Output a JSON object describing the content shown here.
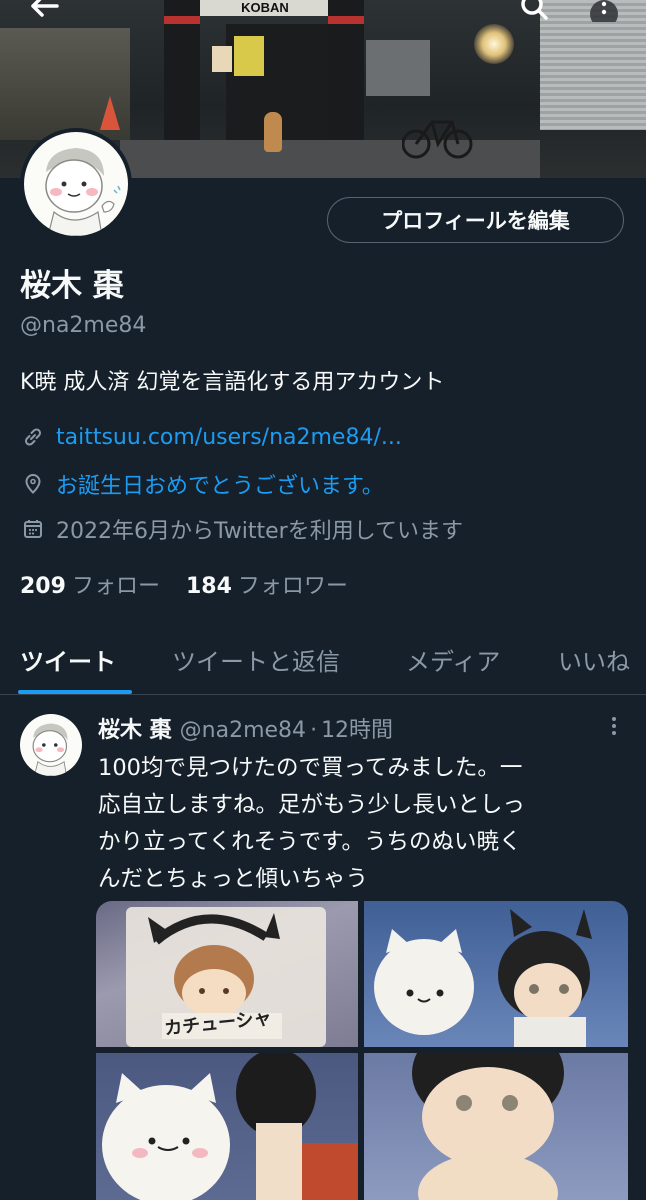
{
  "banner": {
    "sign_text": "KOBAN"
  },
  "topbar": {
    "back_icon": "arrow-left-icon",
    "search_icon": "search-icon",
    "more_icon": "more-vertical-icon"
  },
  "profile": {
    "edit_button_label": "プロフィールを編集",
    "display_name": "桜木 棗",
    "handle": "@na2me84",
    "bio": "K暁 成人済  幻覚を言語化する用アカウント",
    "website": "taittsuu.com/users/na2me84/...",
    "location": "お誕生日おめでとうございます。",
    "joined": "2022年6月からTwitterを利用しています",
    "following_count": "209",
    "following_label": "フォロー",
    "followers_count": "184",
    "followers_label": "フォロワー"
  },
  "tabs": [
    {
      "label": "ツイート",
      "active": true
    },
    {
      "label": "ツイートと返信",
      "active": false
    },
    {
      "label": "メディア",
      "active": false
    },
    {
      "label": "いいね",
      "active": false
    }
  ],
  "tweet": {
    "author_name": "桜木 棗",
    "author_handle": "@na2me84",
    "separator": "·",
    "time": "12時間",
    "text_lines": [
      "100均で見つけたので買ってみました。一",
      "応自立しますね。足がもう少し長いとしっ",
      "かり立ってくれそうです。うちのぬい暁く",
      "んだとちょっと傾いちゃう"
    ],
    "media_label_text": "カチューシャ"
  },
  "colors": {
    "background": "#15202b",
    "accent": "#1d9bf0",
    "muted_text": "#8b98a5",
    "border": "#38444d"
  }
}
